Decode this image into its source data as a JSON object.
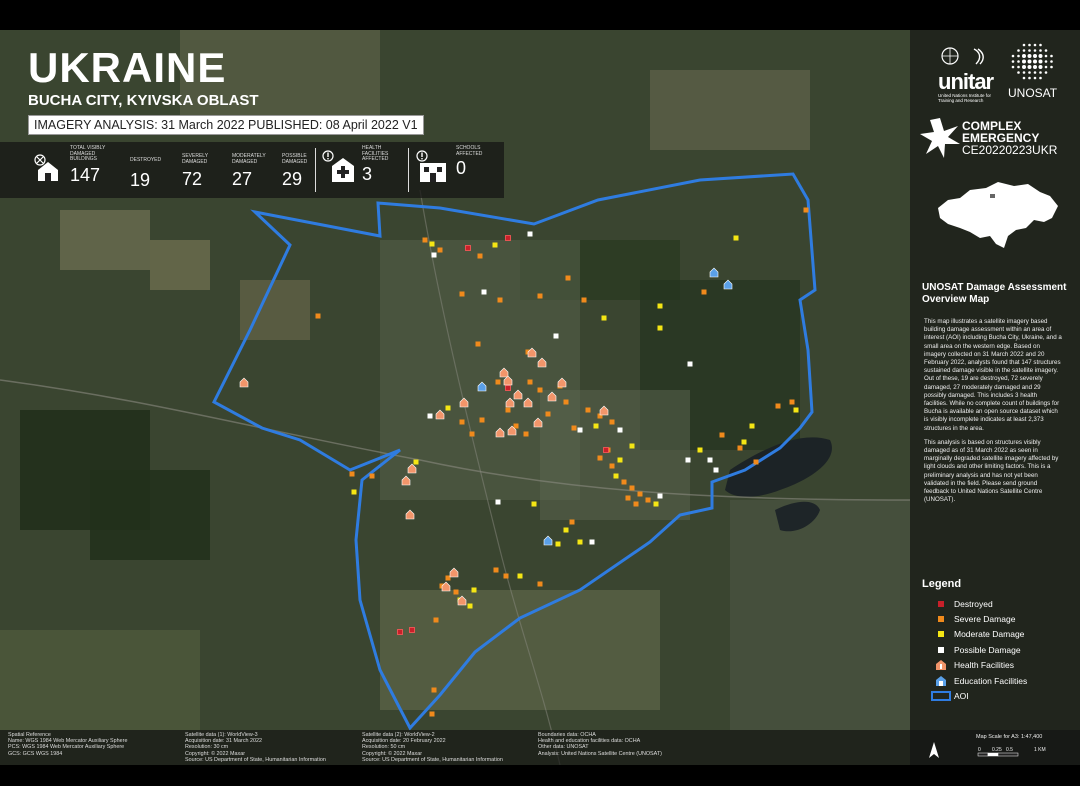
{
  "header": {
    "title": "UKRAINE",
    "subtitle": "BUCHA CITY, KYIVSKA OBLAST",
    "imagery_line": "IMAGERY ANALYSIS: 31 March 2022 PUBLISHED: 08 April 2022 V1"
  },
  "stats": {
    "total": {
      "label": "TOTAL VISIBLY DAMAGED BUILDINGS",
      "value": "147"
    },
    "destroyed": {
      "label": "DESTROYED",
      "value": "19"
    },
    "severe": {
      "label": "SEVERELY DAMAGED",
      "value": "72"
    },
    "moderate": {
      "label": "MODERATELY DAMAGED",
      "value": "27"
    },
    "possible": {
      "label": "POSSIBLE DAMAGED",
      "value": "29"
    },
    "health": {
      "label": "HEALTH FACILITIES AFFECTED",
      "value": "3"
    },
    "schools": {
      "label": "SCHOOLS AFFECTED",
      "value": "0"
    }
  },
  "brand": {
    "unitar": "unitar",
    "unitar_sub": "United Nations Institute for Training and Research",
    "unosat": "UNOSAT",
    "ce_line1": "COMPLEX",
    "ce_line2": "EMERGENCY",
    "ce_code": "CE20220223UKR"
  },
  "description": {
    "title": "UNOSAT Damage Assessment Overview Map",
    "para1": "This map illustrates a satellite imagery based building damage assessment within an area of interest (AOI) including Bucha City, Ukraine, and a small area on the western edge. Based on imagery collected on 31 March 2022 and 20 February 2022, analysts found that 147 structures sustained damage visible in the satellite imagery. Out of these, 19 are destroyed, 72 severely damaged, 27 moderately damaged and 29 possibly damaged. This includes 3 health facilities. While no complete count of buildings for Bucha is available an open source dataset which is visibly incomplete indicates at least 2,373 structures in the area.",
    "para2": "This analysis is based on structures visibly damaged as of 31 March 2022 as seen in marginally degraded satellite imagery affected by light clouds and other limiting factors. This is a preliminary analysis and has not yet been validated in the field. Please send ground feedback to United Nations Satellite Centre (UNOSAT)."
  },
  "legend": {
    "title": "Legend",
    "items": [
      {
        "label": "Destroyed",
        "color": "#c8202a",
        "kind": "square"
      },
      {
        "label": "Severe Damage",
        "color": "#f08a1c",
        "kind": "square"
      },
      {
        "label": "Moderate Damage",
        "color": "#f5e614",
        "kind": "square"
      },
      {
        "label": "Possible Damage",
        "color": "#ffffff",
        "kind": "square"
      },
      {
        "label": "Health Facilities",
        "color": "#f2956a",
        "kind": "health"
      },
      {
        "label": "Education Facilities",
        "color": "#5aa0e8",
        "kind": "education"
      },
      {
        "label": "AOI",
        "color": "#2f7ce0",
        "kind": "aoi"
      }
    ]
  },
  "footer": {
    "col1": [
      "Spatial Reference",
      "Name: WGS 1984 Web Mercator Auxiliary Sphere",
      "PCS: WGS 1984 Web Mercator Auxiliary Sphere",
      "GCS: GCS WGS 1984"
    ],
    "col2": [
      "Satellite data (1): WorldView-3",
      "Acquisition date: 31 March 2022",
      "Resolution: 30 cm",
      "Copyright: © 2022 Maxar",
      "Source: US Department of State, Humanitarian Information"
    ],
    "col3": [
      "Satellite data (2): WorldView-2",
      "Acquisition date: 20 February 2022",
      "Resolution: 50 cm",
      "Copyright: © 2022 Maxar",
      "Source: US Department of State, Humanitarian Information"
    ],
    "col4": [
      "Boundaries data: OCHA",
      "Health and education facilities data: OCHA",
      "Other data: UNOSAT",
      "Analysis: United Nations Satellite Centre (UNOSAT)"
    ],
    "scale": "Map Scale for A3: 1:47,400",
    "scale_ticks": [
      "0",
      "0.25",
      "0.5",
      "1 KM"
    ]
  }
}
